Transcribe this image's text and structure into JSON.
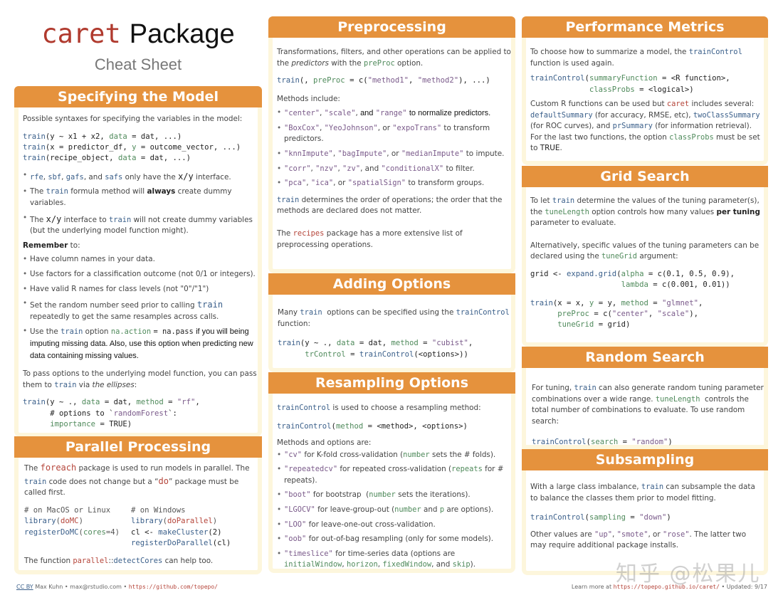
{
  "title": {
    "caret": "caret",
    "package": "Package",
    "subtitle": "Cheat Sheet"
  },
  "sections": {
    "specifying_model": {
      "header": "Specifying the Model",
      "intro": "Possible syntaxes for specifying the variables in the model:",
      "code_lines": [
        "train(y ~ x1 + x2, data = dat, ...)",
        "train(x = predictor_df, y = outcome_vector, ...)",
        "train(recipe_object, data = dat, ...)"
      ],
      "bullets": [
        "rfe, sbf, gafs, and safs only have the x/y interface.",
        "The train formula method will always create dummy variables.",
        "The x/y interface to train will not create dummy variables (but the underlying model function might)."
      ],
      "remember_label": "Remember",
      "remember_suffix": " to:",
      "remember_items": [
        "Have column names in your data.",
        "Use factors for a classification outcome (not 0/1 or integers).",
        "Have valid R names for class levels (not \"0\"/\"1\")",
        "Set the random number seed prior to calling train repeatedly to get the same resamples across calls.",
        "Use the train option na.action = na.pass if you will being imputing missing data. Also, use this option when predicting new data containing missing values."
      ],
      "ellipses_text": "To pass options to the underlying model function, you can pass them to train via the ellipses:",
      "ellipses_code": [
        "train(y ~ ., data = dat, method = \"rf\",",
        "      # options to `randomForest`:",
        "      importance = TRUE)"
      ]
    },
    "parallel": {
      "header": "Parallel Processing",
      "intro": "The foreach package is used to run models in parallel. The train code does not change but a \"do\" package must be called first.",
      "mac_code": [
        "# on MacOS or Linux",
        "library(doMC)",
        "registerDoMC(cores=4)"
      ],
      "win_code": [
        "# on Windows",
        "library(doParallel)",
        "cl <- makeCluster(2)",
        "registerDoParallel(cl)"
      ],
      "outro": "The function parallel::detectCores can help too."
    },
    "preprocessing": {
      "header": "Preprocessing",
      "intro": "Transformations, filters, and other operations can be applied to the predictors with the preProc option.",
      "code": "train(, preProc = c(\"method1\", \"method2\"), ...)",
      "methods_label": "Methods include:",
      "bullets": [
        "\"center\", \"scale\", and \"range\" to normalize predictors.",
        "\"BoxCox\", \"YeoJohnson\", or \"expoTrans\" to transform predictors.",
        "\"knnImpute\", \"bagImpute\", or \"medianImpute\" to impute.",
        "\"corr\", \"nzv\", \"zv\", and \"conditionalX\" to filter.",
        "\"pca\", \"ica\", or \"spatialSign\" to transform groups."
      ],
      "order_text": "train determines the order of operations; the order that the methods are declared does not matter.",
      "recipes_text": "The recipes package has a more extensive list of preprocessing operations."
    },
    "adding_options": {
      "header": "Adding Options",
      "intro": "Many train options can be specified using the trainControl function:",
      "code": [
        "train(y ~ ., data = dat, method = \"cubist\",",
        "      trControl = trainControl(<options>))"
      ]
    },
    "resampling": {
      "header": "Resampling Options",
      "intro": "trainControl is used to choose a resampling method:",
      "code": "trainControl(method = <method>, <options>)",
      "methods_label": "Methods and options are:",
      "bullets": [
        "\"cv\" for K-fold cross-validation (number sets the # folds).",
        "\"repeatedcv\" for repeated cross-validation (repeats for # repeats).",
        "\"boot\" for bootstrap (number sets the iterations).",
        "\"LGOCV\" for leave-group-out (number and p are options).",
        "\"LOO\" for leave-one-out cross-validation.",
        "\"oob\" for out-of-bag resampling (only for some models).",
        "\"timeslice\" for time-series data (options are initialWindow, horizon, fixedWindow, and skip)."
      ]
    },
    "performance": {
      "header": "Performance Metrics",
      "intro": "To choose how to summarize a model, the trainControl function is used again.",
      "code": [
        "trainControl(summaryFunction = <R function>,",
        "             classProbs = <logical>)"
      ],
      "body": "Custom R functions can be used but caret includes several: defaultSummary (for accuracy, RMSE, etc), twoClassSummary (for ROC curves), and prSummary (for information retrieval). For the last two functions, the option classProbs must be set to TRUE."
    },
    "grid_search": {
      "header": "Grid Search",
      "intro": "To let train determine the values of the tuning parameter(s), the tuneLength option controls how many values per tuning parameter to evaluate.",
      "alt": "Alternatively, specific values of the tuning parameters can be declared using the tuneGrid argument:",
      "code1": [
        "grid <- expand.grid(alpha = c(0.1, 0.5, 0.9),",
        "                    lambda = c(0.001, 0.01))"
      ],
      "code2": [
        "train(x = x, y = y, method = \"glmnet\",",
        "      preProc = c(\"center\", \"scale\"),",
        "      tuneGrid = grid)"
      ]
    },
    "random_search": {
      "header": "Random Search",
      "intro": "For tuning, train can also generate random tuning parameter combinations over a wide range. tuneLength controls the total number of combinations to evaluate. To use random search:",
      "code": "trainControl(search = \"random\")"
    },
    "subsampling": {
      "header": "Subsampling",
      "intro": "With a large class imbalance, train can subsample the data to balance the classes them prior to model fitting.",
      "code": "trainControl(sampling = \"down\")",
      "outro": "Other values are \"up\", \"smote\", or \"rose\". The latter two may require additional package installs."
    }
  },
  "footer": {
    "left_cc": "CC BY",
    "left_author": " Max Kuhn • max@rstudio.com • ",
    "left_link": "https://github.com/topepo/",
    "right_prefix": "Learn more at ",
    "right_link": "https://topepo.github.io/caret/",
    "right_suffix": " • Updated: 9/17"
  },
  "watermark": "知乎 @松果儿",
  "colors": {
    "header_orange": "#e5923d",
    "border_cream": "#fdf6dc",
    "caret_red": "#b03a2e",
    "fn_blue": "#3a5f8a",
    "arg_green": "#4f8a5b",
    "str_purple": "#7a5a8a"
  }
}
